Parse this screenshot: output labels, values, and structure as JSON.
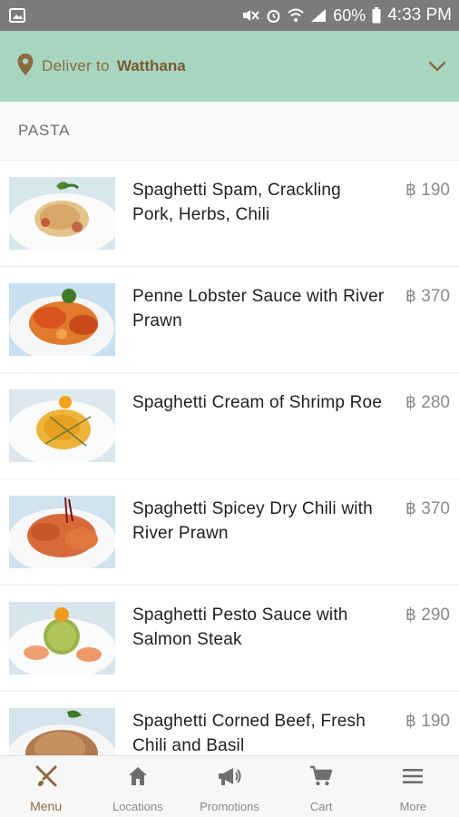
{
  "status_bar": {
    "battery": "60%",
    "time": "4:33 PM"
  },
  "delivery": {
    "label": "Deliver to",
    "location": "Watthana"
  },
  "section": {
    "title": "PASTA"
  },
  "menu_items": [
    {
      "name": "Spaghetti Spam, Crackling Pork, Herbs, Chili",
      "price": "฿ 190"
    },
    {
      "name": "Penne Lobster Sauce with River Prawn",
      "price": "฿ 370"
    },
    {
      "name": "Spaghetti Cream of Shrimp Roe",
      "price": "฿ 280"
    },
    {
      "name": "Spaghetti Spicey Dry Chili with River Prawn",
      "price": "฿ 370"
    },
    {
      "name": "Spaghetti Pesto Sauce with Salmon Steak",
      "price": "฿ 290"
    },
    {
      "name": "Spaghetti Corned Beef, Fresh Chili and Basil",
      "price": "฿ 190"
    }
  ],
  "bottom_nav": [
    {
      "label": "Menu",
      "icon": "fork-spoon-icon",
      "active": true
    },
    {
      "label": "Locations",
      "icon": "home-icon",
      "active": false
    },
    {
      "label": "Promotions",
      "icon": "megaphone-icon",
      "active": false
    },
    {
      "label": "Cart",
      "icon": "cart-icon",
      "active": false
    },
    {
      "label": "More",
      "icon": "menu-lines-icon",
      "active": false
    }
  ],
  "colors": {
    "delivery_bar": "#a8d5c2",
    "accent_brown": "#8b6a3e",
    "status_bar": "#7b7b7b"
  }
}
